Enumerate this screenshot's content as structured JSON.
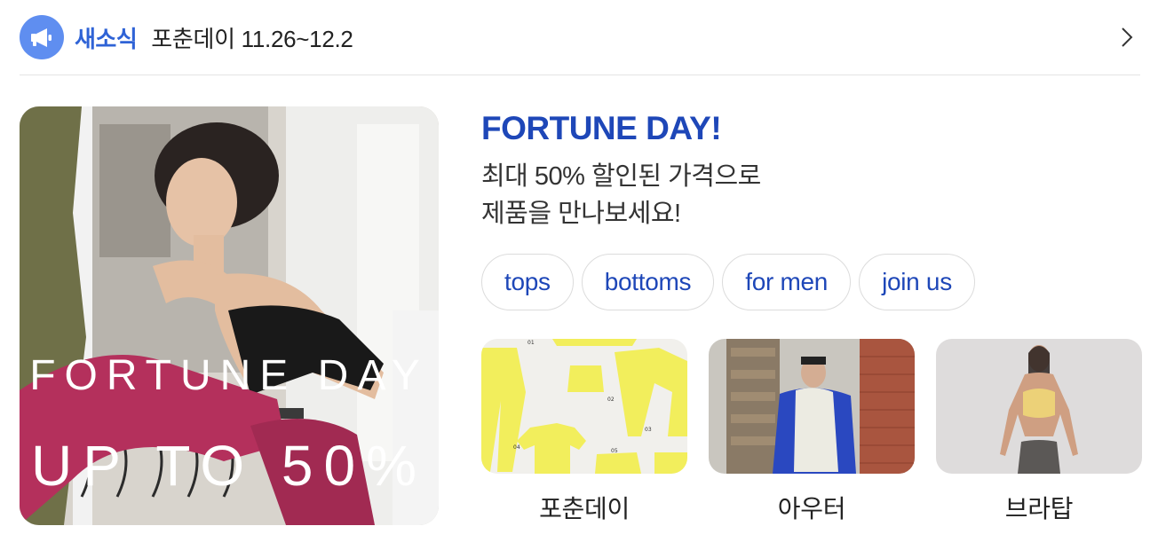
{
  "news": {
    "icon": "megaphone-icon",
    "label": "새소식",
    "text": "포춘데이 11.26~12.2",
    "chevron_icon": "chevron-right-icon"
  },
  "hero": {
    "line1": "FORTUNE DAY",
    "line2": "UP TO 50%"
  },
  "promo": {
    "title": "FORTUNE DAY!",
    "desc_line1": "최대 50% 할인된 가격으로",
    "desc_line2": "제품을 만나보세요!"
  },
  "chips": [
    "tops",
    "bottoms",
    "for men",
    "join us"
  ],
  "thumbs": [
    {
      "label": "포춘데이",
      "image_text": [
        "01",
        "02",
        "03",
        "04",
        "05"
      ]
    },
    {
      "label": "아우터"
    },
    {
      "label": "브라탑"
    }
  ],
  "colors": {
    "accent": "#2f63d6",
    "title": "#1e47b8",
    "news_icon_bg": "#5f8ef0",
    "yellow": "#f2ee5c"
  }
}
